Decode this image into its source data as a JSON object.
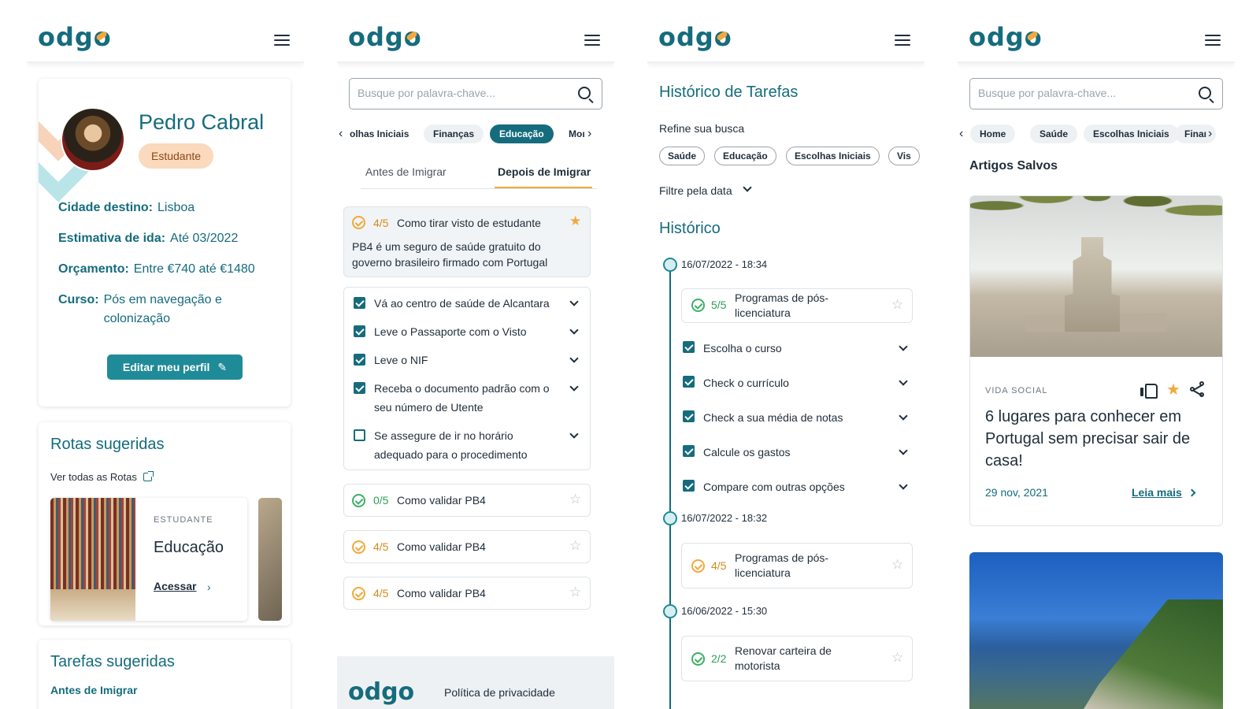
{
  "brand": {
    "logo_text": "odgo",
    "accent": "#156c7d",
    "highlight": "#f2a93b"
  },
  "profile": {
    "name": "Pedro Cabral",
    "role": "Estudante",
    "fields": [
      {
        "label": "Cidade destino:",
        "value": "Lisboa"
      },
      {
        "label": "Estimativa de ida:",
        "value": "Até 03/2022"
      },
      {
        "label": "Orçamento:",
        "value": "Entre €740 até €1480"
      },
      {
        "label": "Curso:",
        "value": "Pós em navegação e colonização"
      }
    ],
    "edit_label": "Editar meu perfil"
  },
  "routes": {
    "title": "Rotas sugeridas",
    "see_all": "Ver todas as Rotas",
    "card": {
      "kicker": "ESTUDANTE",
      "title": "Educação",
      "link": "Acessar"
    }
  },
  "suggested_tasks": {
    "title": "Tarefas sugeridas",
    "subtitle": "Antes de Imigrar"
  },
  "search": {
    "placeholder": "Busque por palavra-chave..."
  },
  "categories_s2": [
    "olhas Iniciais",
    "Finanças",
    "Educação",
    "Moı"
  ],
  "tabs": [
    "Antes de Imigrar",
    "Depois de Imigrar"
  ],
  "task_top": {
    "count": "4/5",
    "title": "Como tirar visto de estudante",
    "desc": "PB4 é um seguro de saúde gratuito do governo brasileiro firmado com Portugal"
  },
  "checklist": [
    {
      "text": "Vá ao centro de saúde de Alcantara",
      "checked": true
    },
    {
      "text": "Leve o Passaporte com o Visto",
      "checked": true
    },
    {
      "text": "Leve o NIF",
      "checked": true
    },
    {
      "text": "Receba o documento padrão com o seu número de Utente",
      "checked": true
    },
    {
      "text": "Se assegure de ir no horário adequado para o procedimento",
      "checked": false
    }
  ],
  "tasks_more": [
    {
      "count": "0/5",
      "title": "Como validar PB4"
    },
    {
      "count": "4/5",
      "title": "Como validar PB4"
    },
    {
      "count": "4/5",
      "title": "Como validar PB4"
    }
  ],
  "footer": {
    "logo": "odgo",
    "link": "Política de privacidade"
  },
  "history": {
    "title": "Histórico de Tarefas",
    "refine": "Refine sua busca",
    "filters": [
      "Saúde",
      "Educação",
      "Escolhas Iniciais",
      "Vis"
    ],
    "date_filter": "Filtre pela data",
    "section": "Histórico",
    "entries": [
      {
        "date": "16/07/2022 - 18:34",
        "count": "5/5",
        "title": "Programas de pós-licenciatura"
      },
      {
        "date": "16/07/2022 - 18:32",
        "count": "4/5",
        "title": "Programas de pós-licenciatura"
      },
      {
        "date": "16/06/2022 - 15:30",
        "count": "2/2",
        "title": "Renovar carteira de motorista"
      }
    ],
    "sub_items": [
      "Escolha o curso",
      "Check o currículo",
      "Check a sua média de notas",
      "Calcule os gastos",
      "Compare com outras opções"
    ]
  },
  "categories_s4": [
    "Home",
    "Saúde",
    "Escolhas Iniciais",
    "Finaı"
  ],
  "saved": {
    "title": "Artigos Salvos",
    "article": {
      "kicker": "VIDA SOCIAL",
      "title": "6 lugares para conhecer em Portugal sem precisar sair de casa!",
      "date": "29 nov, 2021",
      "more": "Leia mais"
    }
  }
}
